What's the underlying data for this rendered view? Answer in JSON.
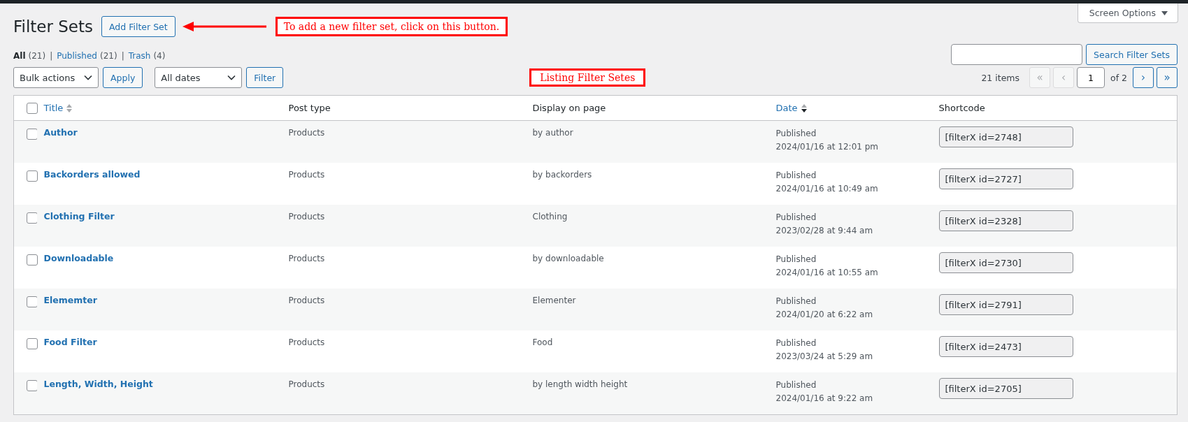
{
  "page": {
    "title": "Filter Sets",
    "add_button": "Add Filter Set",
    "screen_options": "Screen Options"
  },
  "annotations": [
    {
      "kind": "arrow-note",
      "text": "To add a new filter set, click on this button."
    },
    {
      "kind": "note",
      "text": "Listing Filter Setes"
    }
  ],
  "view_separator": "|",
  "views": [
    {
      "label": "All",
      "count": "(21)",
      "selected": true
    },
    {
      "label": "Published",
      "count": "(21)",
      "selected": false
    },
    {
      "label": "Trash",
      "count": "(4)",
      "selected": false
    }
  ],
  "search": {
    "button": "Search Filter Sets"
  },
  "bulk_actions": {
    "dropdown": "Bulk actions",
    "button": "Apply"
  },
  "date_filter": {
    "dropdown": "All dates",
    "button": "Filter"
  },
  "pagination": {
    "items": "21 items",
    "buttons_before": [
      {
        "label": "«",
        "disabled": true
      },
      {
        "label": "‹",
        "disabled": true
      }
    ],
    "current_page": "1",
    "total": "of 2",
    "buttons_after": [
      {
        "label": "›",
        "disabled": false
      },
      {
        "label": "»",
        "disabled": false
      }
    ]
  },
  "table": {
    "select_all": {
      "checked": false
    },
    "columns": [
      {
        "label": "Title",
        "sortable": true,
        "sorted": false
      },
      {
        "label": "Post type",
        "sortable": false
      },
      {
        "label": "Display on page",
        "sortable": false
      },
      {
        "label": "Date",
        "sortable": true,
        "sorted": true
      },
      {
        "label": "Shortcode",
        "sortable": false
      }
    ],
    "rows": [
      {
        "checked": false,
        "title": "Author",
        "post_type": "Products",
        "display": "by author",
        "status": "Published",
        "date": "2024/01/16 at 12:01 pm",
        "shortcode": "[filterX id=2748]"
      },
      {
        "checked": false,
        "title": "Backorders allowed",
        "post_type": "Products",
        "display": "by backorders",
        "status": "Published",
        "date": "2024/01/16 at 10:49 am",
        "shortcode": "[filterX id=2727]"
      },
      {
        "checked": false,
        "title": "Clothing Filter",
        "post_type": "Products",
        "display": "Clothing",
        "status": "Published",
        "date": "2023/02/28 at 9:44 am",
        "shortcode": "[filterX id=2328]"
      },
      {
        "checked": false,
        "title": "Downloadable",
        "post_type": "Products",
        "display": "by downloadable",
        "status": "Published",
        "date": "2024/01/16 at 10:55 am",
        "shortcode": "[filterX id=2730]"
      },
      {
        "checked": false,
        "title": "Elememter",
        "post_type": "Products",
        "display": "Elementer",
        "status": "Published",
        "date": "2024/01/20 at 6:22 am",
        "shortcode": "[filterX id=2791]"
      },
      {
        "checked": false,
        "title": "Food Filter",
        "post_type": "Products",
        "display": "Food",
        "status": "Published",
        "date": "2023/03/24 at 5:29 am",
        "shortcode": "[filterX id=2473]"
      },
      {
        "checked": false,
        "title": "Length, Width, Height",
        "post_type": "Products",
        "display": "by length width height",
        "status": "Published",
        "date": "2024/01/16 at 9:22 am",
        "shortcode": "[filterX id=2705]"
      }
    ]
  }
}
